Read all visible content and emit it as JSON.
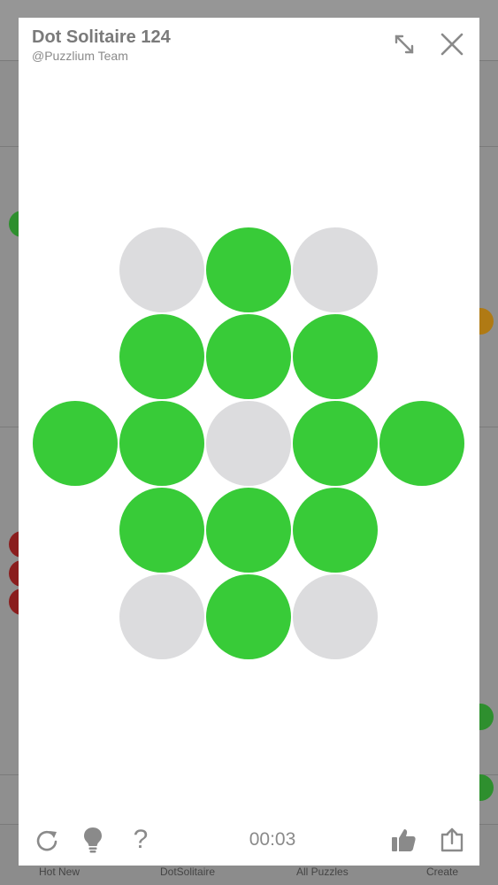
{
  "background": {
    "tabs": [
      "Hot New",
      "DotSolitaire",
      "All Puzzles",
      "Create"
    ]
  },
  "modal": {
    "title": "Dot Solitaire 124",
    "author": "@Puzzlium Team",
    "timer": "00:03"
  },
  "board": {
    "green_color": "#38cb38",
    "empty_color": "#dcdcde",
    "cells": [
      {
        "row": 0,
        "col": 1,
        "state": "empty"
      },
      {
        "row": 0,
        "col": 2,
        "state": "peg"
      },
      {
        "row": 0,
        "col": 3,
        "state": "empty"
      },
      {
        "row": 1,
        "col": 1,
        "state": "peg"
      },
      {
        "row": 1,
        "col": 2,
        "state": "peg"
      },
      {
        "row": 1,
        "col": 3,
        "state": "peg"
      },
      {
        "row": 2,
        "col": 0,
        "state": "peg"
      },
      {
        "row": 2,
        "col": 1,
        "state": "peg"
      },
      {
        "row": 2,
        "col": 2,
        "state": "empty"
      },
      {
        "row": 2,
        "col": 3,
        "state": "peg"
      },
      {
        "row": 2,
        "col": 4,
        "state": "peg"
      },
      {
        "row": 3,
        "col": 1,
        "state": "peg"
      },
      {
        "row": 3,
        "col": 2,
        "state": "peg"
      },
      {
        "row": 3,
        "col": 3,
        "state": "peg"
      },
      {
        "row": 4,
        "col": 1,
        "state": "empty"
      },
      {
        "row": 4,
        "col": 2,
        "state": "peg"
      },
      {
        "row": 4,
        "col": 3,
        "state": "empty"
      }
    ]
  }
}
